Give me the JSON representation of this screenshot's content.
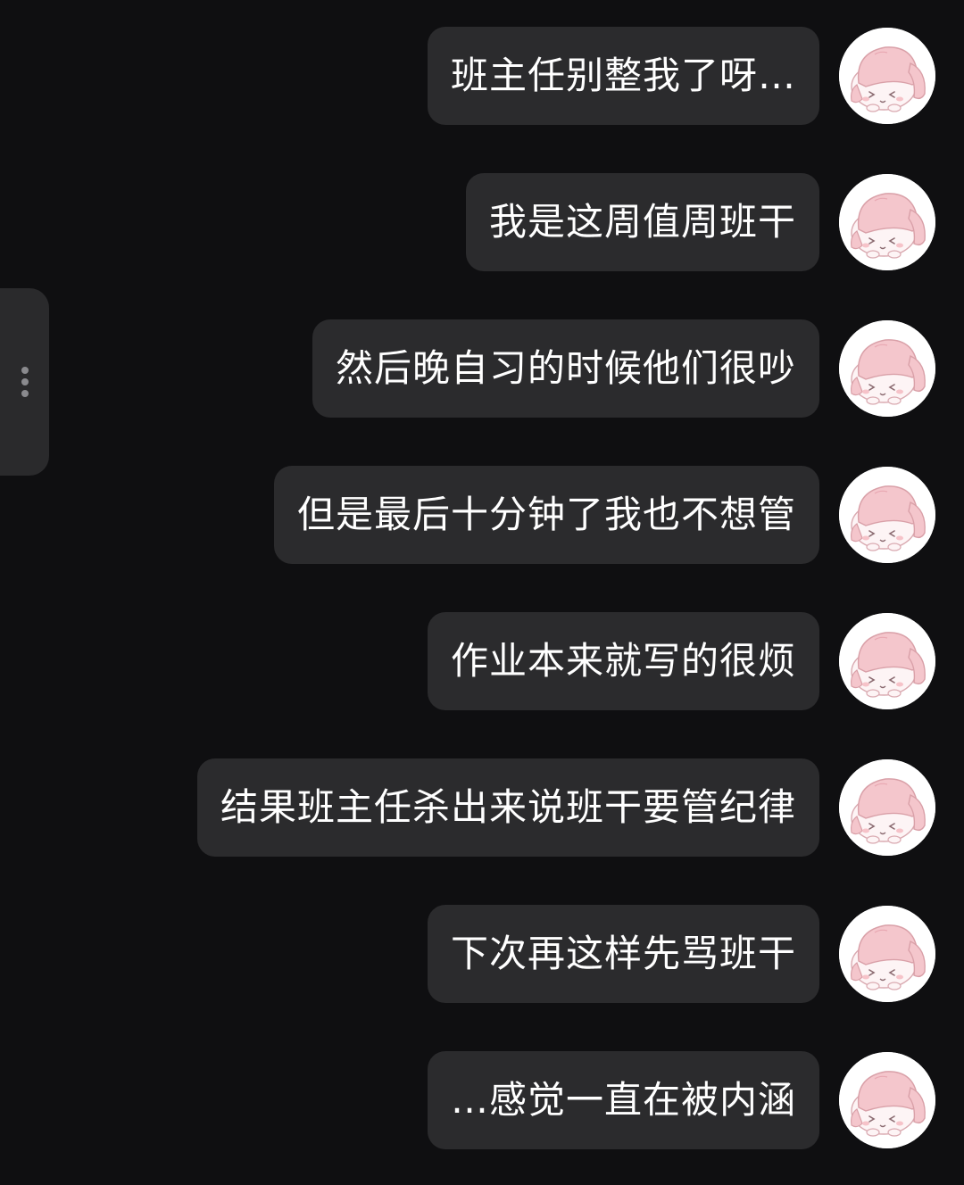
{
  "chat": {
    "messages": [
      {
        "text": "班主任别整我了呀…",
        "avatar_icon": "pink-bunny-avatar-icon"
      },
      {
        "text": "我是这周值周班干",
        "avatar_icon": "pink-bunny-avatar-icon"
      },
      {
        "text": "然后晚自习的时候他们很吵",
        "avatar_icon": "pink-bunny-avatar-icon"
      },
      {
        "text": "但是最后十分钟了我也不想管",
        "avatar_icon": "pink-bunny-avatar-icon"
      },
      {
        "text": "作业本来就写的很烦",
        "avatar_icon": "pink-bunny-avatar-icon"
      },
      {
        "text": "结果班主任杀出来说班干要管纪律",
        "avatar_icon": "pink-bunny-avatar-icon"
      },
      {
        "text": "下次再这样先骂班干",
        "avatar_icon": "pink-bunny-avatar-icon"
      },
      {
        "text": "…感觉一直在被内涵",
        "avatar_icon": "pink-bunny-avatar-icon"
      }
    ]
  },
  "side_handle": {
    "icon": "vertical-ellipsis-icon"
  },
  "colors": {
    "background": "#0f0f11",
    "bubble": "#2b2b2d",
    "text": "#ffffff",
    "avatar_bg": "#ffffff",
    "avatar_accent": "#f4c6cc"
  }
}
